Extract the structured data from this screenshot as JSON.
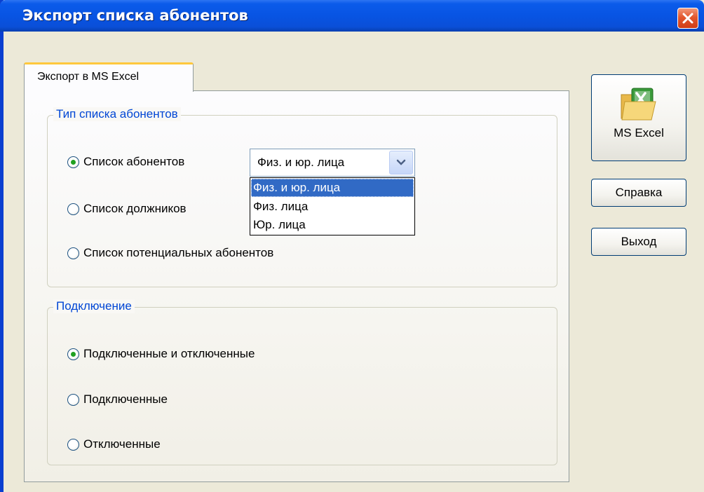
{
  "window": {
    "title": "Экспорт списка абонентов"
  },
  "tabs": [
    {
      "label": "Экспорт в MS Excel",
      "active": true
    }
  ],
  "list_type_group": {
    "legend": "Тип списка абонентов",
    "options": [
      {
        "label": "Список абонентов",
        "checked": true
      },
      {
        "label": "Список должников",
        "checked": false
      },
      {
        "label": "Список потенциальных абонентов",
        "checked": false
      }
    ]
  },
  "person_type_combo": {
    "value": "Физ. и юр. лица",
    "options": [
      "Физ. и юр. лица",
      "Физ. лица",
      "Юр. лица"
    ],
    "selected_index": 0
  },
  "connection_group": {
    "legend": "Подключение",
    "options": [
      {
        "label": "Подключенные и отключенные",
        "checked": true
      },
      {
        "label": "Подключенные",
        "checked": false
      },
      {
        "label": "Отключенные",
        "checked": false
      }
    ]
  },
  "buttons": {
    "excel": "MS Excel",
    "help": "Справка",
    "exit": "Выход"
  },
  "colors": {
    "titlebar": "#0854e3",
    "legend_text": "#0046d5",
    "selection": "#316ac5",
    "radio_dot": "#21a121",
    "tab_highlight": "#ffc83c"
  }
}
